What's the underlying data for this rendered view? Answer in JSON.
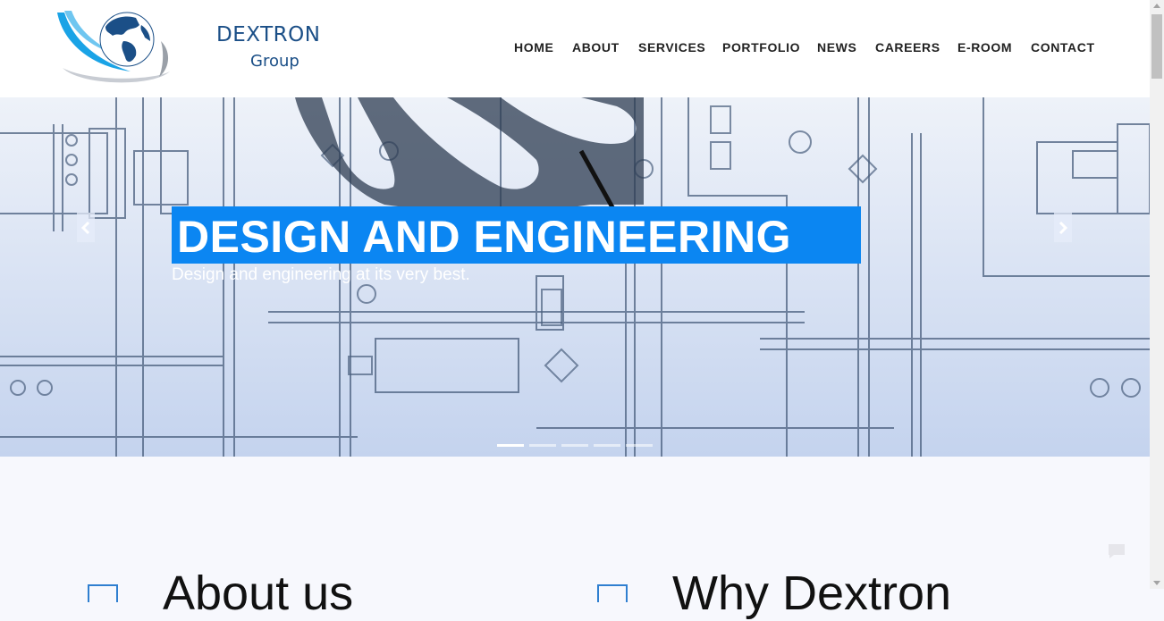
{
  "brand": {
    "name": "DEXTRON",
    "sub": "Group",
    "primary_color": "#1b4f87",
    "accent_color": "#1aa3e6"
  },
  "nav": {
    "items": [
      "HOME",
      "ABOUT",
      "SERVICES",
      "PORTFOLIO",
      "NEWS",
      "CAREERS",
      "E-ROOM",
      "CONTACT"
    ]
  },
  "hero": {
    "title": "DESIGN AND ENGINEERING",
    "subtitle": "Design and engineering at its very best.",
    "title_bg": "#0b86f2",
    "slide_count": 5,
    "active_slide": 1,
    "prev_icon": "chevron-left-icon",
    "next_icon": "chevron-right-icon"
  },
  "sections": {
    "about_title": "About us",
    "why_title": "Why Dextron"
  }
}
